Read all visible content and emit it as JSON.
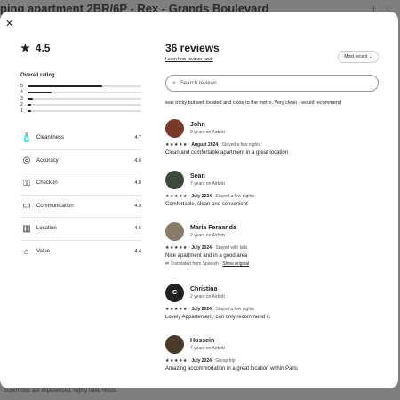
{
  "backdrop": {
    "title": "ping apartment 2BR/6P - Rex - Grands Boulevard",
    "footer": "Superhosts are experienced, highly rated Hosts."
  },
  "modal": {
    "close_icon": "close-icon",
    "rating": "4.5",
    "overall_label": "Overall rating",
    "distribution": [
      {
        "stars": "5",
        "fraction": 0.66
      },
      {
        "stars": "4",
        "fraction": 0.21
      },
      {
        "stars": "3",
        "fraction": 0.05
      },
      {
        "stars": "2",
        "fraction": 0.03
      },
      {
        "stars": "1",
        "fraction": 0.03
      }
    ],
    "categories": [
      {
        "label": "Cleanliness",
        "score": "4.7",
        "icon": "spray-bottle-icon"
      },
      {
        "label": "Accuracy",
        "score": "4.6",
        "icon": "check-circle-icon"
      },
      {
        "label": "Check-in",
        "score": "4.8",
        "icon": "key-icon"
      },
      {
        "label": "Communication",
        "score": "4.9",
        "icon": "chat-bubble-icon"
      },
      {
        "label": "Location",
        "score": "4.6",
        "icon": "map-icon"
      },
      {
        "label": "Value",
        "score": "4.4",
        "icon": "tag-icon"
      }
    ],
    "reviews_title": "36 reviews",
    "learn_link": "Learn how reviews work",
    "sort_label": "Most recent",
    "search_placeholder": "Search reviews",
    "prev_snippet": "was tricky but well located and close to the metro. Very clean - would recommend",
    "reviews": [
      {
        "name": "John",
        "tenure": "9 years on Airbnb",
        "stars": "★★★★★",
        "date": "August 2024",
        "trip": "Stayed a few nights",
        "text": "Clean and comfortable apartment in a great location",
        "avatar_color": "#7a3a2a",
        "initial": ""
      },
      {
        "name": "Sean",
        "tenure": "7 years on Airbnb",
        "stars": "★★★★★",
        "date": "July 2024",
        "trip": "Stayed a few nights",
        "text": "Comfortable, clean and convenient",
        "avatar_color": "#3c4a3a",
        "initial": ""
      },
      {
        "name": "Maria Fernanda",
        "tenure": "2 years on Airbnb",
        "stars": "★★★★★",
        "date": "July 2024",
        "trip": "Stayed with kids",
        "text": "Nice apartment and in a good area",
        "translated": "Translated from Spanish",
        "show_original": "Show original",
        "avatar_color": "#8a7a6a",
        "initial": ""
      },
      {
        "name": "Christina",
        "tenure": "2 years on Airbnb",
        "stars": "★★★★★",
        "date": "July 2024",
        "trip": "Stayed a few nights",
        "text": "Lovely Appartement, can only recommend it.",
        "avatar_color": "#222222",
        "initial": "C"
      },
      {
        "name": "Hussein",
        "tenure": "4 years on Airbnb",
        "stars": "★★★★★",
        "date": "July 2024",
        "trip": "Group trip",
        "text": "Amazing accommodation in a great location within Paris",
        "avatar_color": "#4a3a2a",
        "initial": ""
      }
    ]
  }
}
